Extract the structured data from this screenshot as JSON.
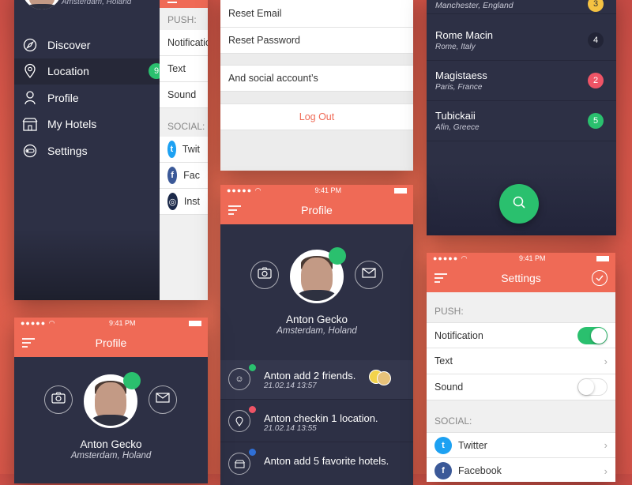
{
  "status": {
    "time": "9:41 PM"
  },
  "menu": {
    "user_location": "Amsterdam, Holand",
    "items": [
      {
        "label": "Discover"
      },
      {
        "label": "Location",
        "badge": "9"
      },
      {
        "label": "Profile"
      },
      {
        "label": "My Hotels"
      },
      {
        "label": "Settings"
      }
    ]
  },
  "settings_partial": {
    "push_header": "PUSH:",
    "rows": [
      "Notificatio",
      "Text",
      "Sound"
    ],
    "social_header": "SOCIAL:",
    "social": [
      {
        "label": "Twit",
        "color": "#1da1f2"
      },
      {
        "label": "Fac",
        "color": "#3b5998"
      },
      {
        "label": "Inst",
        "color": "#1c2a4a"
      }
    ]
  },
  "account": {
    "reset_email": "Reset Email",
    "reset_password": "Reset Password",
    "social_accounts": "And social account’s",
    "logout": "Log Out"
  },
  "ranking": {
    "top_location": "Manchester, England",
    "top_badge": "3",
    "items": [
      {
        "name": "Rome Macin",
        "location": "Rome, Italy",
        "badge": "4",
        "color": "#222436"
      },
      {
        "name": "Magistaess",
        "location": "Paris, France",
        "badge": "2",
        "color": "#ef5466"
      },
      {
        "name": "Tubickaii",
        "location": "Afin, Greece",
        "badge": "5",
        "color": "#2ac06e"
      }
    ],
    "fab_color": "#2ac06e"
  },
  "profile": {
    "title": "Profile",
    "name": "Anton Gecko",
    "location": "Amsterdam, Holand",
    "activity": [
      {
        "text": "Anton add 2 friends.",
        "date": "21.02.14 13:57",
        "dot": "#2ac06e"
      },
      {
        "text": "Anton checkin 1 location.",
        "date": "21.02.14 13:55",
        "dot": "#ef5466"
      },
      {
        "text": "Anton add 5 favorite hotels.",
        "date": "",
        "dot": "#2f6fd6"
      }
    ]
  },
  "settings": {
    "title": "Settings",
    "push_header": "PUSH:",
    "notification": "Notification",
    "text": "Text",
    "sound": "Sound",
    "social_header": "SOCIAL:",
    "twitter": "Twitter",
    "facebook": "Facebook",
    "toggle_on_color": "#2ac06e"
  }
}
